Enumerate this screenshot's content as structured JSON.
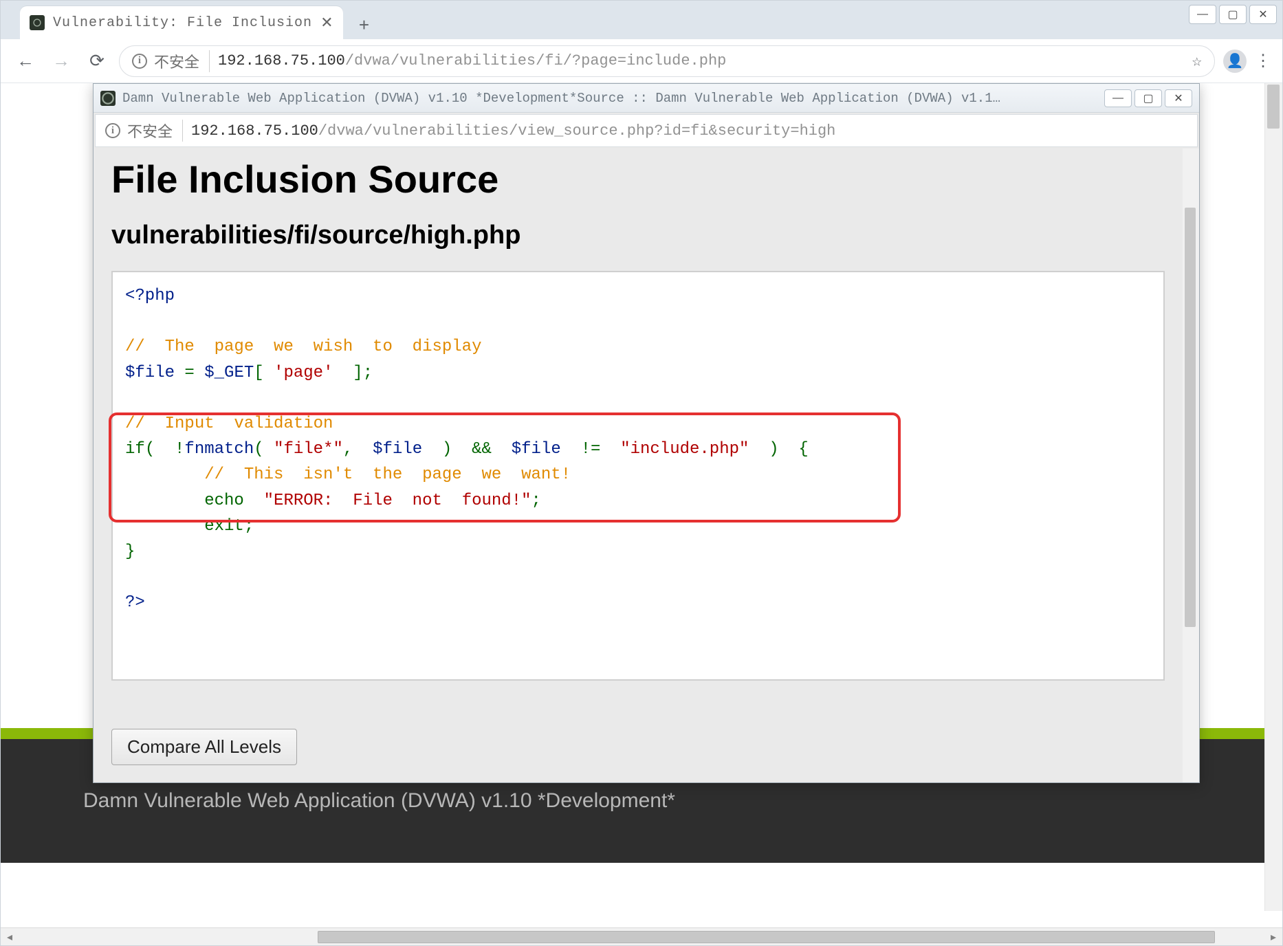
{
  "chrome": {
    "tab": {
      "title": "Vulnerability: File Inclusion"
    },
    "omnibox": {
      "security_label": "不安全",
      "url_dark": "192.168.75.100",
      "url_grey": "/dvwa/vulnerabilities/fi/?page=include.php"
    }
  },
  "popup": {
    "title": "Damn Vulnerable Web Application (DVWA) v1.10 *Development*Source :: Damn Vulnerable Web Application (DVWA) v1.1…",
    "addr": {
      "security_label": "不安全",
      "url_dark": "192.168.75.100",
      "url_grey": "/dvwa/vulnerabilities/view_source.php?id=fi&security=high"
    },
    "heading": "File Inclusion Source",
    "subheading": "vulnerabilities/fi/source/high.php",
    "code": {
      "open_tag": "<?php",
      "c1": "//  The  page  we  wish  to  display",
      "l_file": "$file",
      "eq": " = ",
      "l_get": "$_GET",
      "l_br_open": "[ ",
      "l_page_str": "'page'",
      "l_br_close": "  ]",
      "semi": ";",
      "c2": "//  Input  validation",
      "if_kw": "if",
      "if_open": "(  !",
      "fn": "fnmatch",
      "if_args_a": "( ",
      "str_file": "\"file*\"",
      "comma1": ",  ",
      "arg_file": "$file",
      "if_args_b": "  )  &&  ",
      "arg_file2": "$file",
      "neq": "  !=  ",
      "str_inc": "\"include.php\"",
      "if_close": "  )  {",
      "c3": "        //  This  isn't  the  page  we  want!",
      "echo_kw": "        echo",
      "sp": "  ",
      "str_err": "\"ERROR:  File  not  found!\"",
      "exit_kw": "        exit",
      "brace_close": "}",
      "close_tag": "?>"
    },
    "compare_btn": "Compare All Levels"
  },
  "footer": {
    "text": "Damn Vulnerable Web Application (DVWA) v1.10 *Development*"
  }
}
